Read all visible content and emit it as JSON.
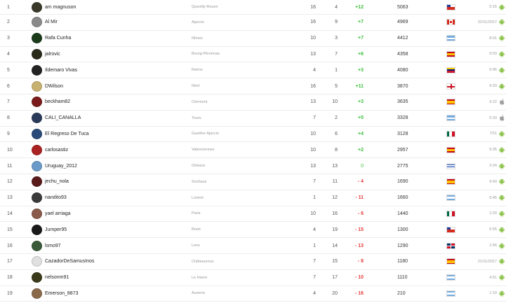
{
  "leaderboard": {
    "rows": [
      {
        "rank": "1",
        "name": "am magnuson",
        "team": "Quevilly-Rouen",
        "played": "16",
        "wins": "4",
        "diff": "+12",
        "diff_sign": "pos",
        "points": "5063",
        "flag": "chile",
        "time": "0:15",
        "os": "android",
        "avatar_color": "#3a3a2a"
      },
      {
        "rank": "2",
        "name": "Al Mir",
        "team": "Ajaccio",
        "played": "16",
        "wins": "9",
        "diff": "+7",
        "diff_sign": "pos",
        "points": "4969",
        "flag": "canada",
        "time": "22/11/2017",
        "os": "android",
        "avatar_color": "#8a8a8a"
      },
      {
        "rank": "3",
        "name": "Rafa Cunha",
        "team": "Nîmes",
        "played": "10",
        "wins": "3",
        "diff": "+7",
        "diff_sign": "pos",
        "points": "4412",
        "flag": "argentina",
        "time": "8:01",
        "os": "android",
        "avatar_color": "#1a3a1a"
      },
      {
        "rank": "4",
        "name": "jalrovic",
        "team": "Bourg-Péronnas",
        "played": "13",
        "wins": "7",
        "diff": "+6",
        "diff_sign": "pos",
        "points": "4358",
        "flag": "spain",
        "time": "9:03",
        "os": "android",
        "avatar_color": "#2a2a1a"
      },
      {
        "rank": "5",
        "name": "Ildemaro Vivas",
        "team": "Reims",
        "played": "4",
        "wins": "1",
        "diff": "+3",
        "diff_sign": "pos",
        "points": "4080",
        "flag": "venezuela",
        "time": "6:06",
        "os": "android",
        "avatar_color": "#222222"
      },
      {
        "rank": "6",
        "name": "DWilson",
        "team": "Niort",
        "played": "16",
        "wins": "5",
        "diff": "+11",
        "diff_sign": "pos",
        "points": "3870",
        "flag": "england",
        "time": "9:33",
        "os": "android",
        "avatar_color": "#c8b070"
      },
      {
        "rank": "7",
        "name": "beckham82",
        "team": "Clermont",
        "played": "13",
        "wins": "10",
        "diff": "+3",
        "diff_sign": "pos",
        "points": "3635",
        "flag": "spain",
        "time": "9:22",
        "os": "apple",
        "avatar_color": "#7a1a1a"
      },
      {
        "rank": "8",
        "name": "CALI_CANALLA",
        "team": "Tours",
        "played": "7",
        "wins": "2",
        "diff": "+5",
        "diff_sign": "pos",
        "points": "3328",
        "flag": "argentina",
        "time": "5:33",
        "os": "apple",
        "avatar_color": "#2a3a5a"
      },
      {
        "rank": "9",
        "name": "El Regreso De Tuca",
        "team": "Gazélec Ajaccio",
        "played": "10",
        "wins": "6",
        "diff": "+4",
        "diff_sign": "pos",
        "points": "3128",
        "flag": "mexico",
        "time": "7/11",
        "os": "android",
        "avatar_color": "#2a4a7a"
      },
      {
        "rank": "10",
        "name": "carlosastiz",
        "team": "Valenciennes",
        "played": "10",
        "wins": "8",
        "diff": "+2",
        "diff_sign": "pos",
        "points": "2957",
        "flag": "spain",
        "time": "9:35",
        "os": "android",
        "avatar_color": "#aa2222"
      },
      {
        "rank": "11",
        "name": "Uruguay_2012",
        "team": "Orléans",
        "played": "13",
        "wins": "13",
        "diff": "0",
        "diff_sign": "zero",
        "points": "2775",
        "flag": "uruguay",
        "time": "2:24",
        "os": "android",
        "avatar_color": "#6a9ac8"
      },
      {
        "rank": "12",
        "name": "jechu_nola",
        "team": "Sochaux",
        "played": "7",
        "wins": "11",
        "diff": "- 4",
        "diff_sign": "neg",
        "points": "1690",
        "flag": "spain",
        "time": "9:43",
        "os": "android",
        "avatar_color": "#5a1a1a"
      },
      {
        "rank": "13",
        "name": "nandito93",
        "team": "Lorient",
        "played": "1",
        "wins": "12",
        "diff": "- 11",
        "diff_sign": "neg",
        "points": "1660",
        "flag": "argentina",
        "time": "5:45",
        "os": "android",
        "avatar_color": "#3a3a3a"
      },
      {
        "rank": "14",
        "name": "yael arriaga",
        "team": "Paris",
        "played": "10",
        "wins": "16",
        "diff": "- 6",
        "diff_sign": "neg",
        "points": "1440",
        "flag": "mexico",
        "time": "1:29",
        "os": "android",
        "avatar_color": "#8a5a4a"
      },
      {
        "rank": "15",
        "name": "Jumper95",
        "team": "Brest",
        "played": "4",
        "wins": "19",
        "diff": "- 15",
        "diff_sign": "neg",
        "points": "1300",
        "flag": "chile",
        "time": "6:55",
        "os": "android",
        "avatar_color": "#1a1a1a"
      },
      {
        "rank": "16",
        "name": "lsmo97",
        "team": "Lens",
        "played": "1",
        "wins": "14",
        "diff": "- 13",
        "diff_sign": "neg",
        "points": "1290",
        "flag": "dominican",
        "time": "1:56",
        "os": "android",
        "avatar_color": "#3a5a3a"
      },
      {
        "rank": "17",
        "name": "CazadorDeSamusInos",
        "team": "Châteauroux",
        "played": "7",
        "wins": "15",
        "diff": "- 8",
        "diff_sign": "neg",
        "points": "1180",
        "flag": "spain",
        "time": "21/11/2017",
        "os": "android",
        "avatar_color": "#e0e0e0"
      },
      {
        "rank": "18",
        "name": "nelsonm91",
        "team": "Le Havre",
        "played": "7",
        "wins": "17",
        "diff": "- 10",
        "diff_sign": "neg",
        "points": "1110",
        "flag": "argentina",
        "time": "4:51",
        "os": "android",
        "avatar_color": "#3a3a1a"
      },
      {
        "rank": "19",
        "name": "Emerson_8873",
        "team": "Auxerre",
        "played": "4",
        "wins": "20",
        "diff": "- 16",
        "diff_sign": "neg",
        "points": "210",
        "flag": "argentina",
        "time": "1:19",
        "os": "android",
        "avatar_color": "#8a6a4a"
      }
    ]
  }
}
